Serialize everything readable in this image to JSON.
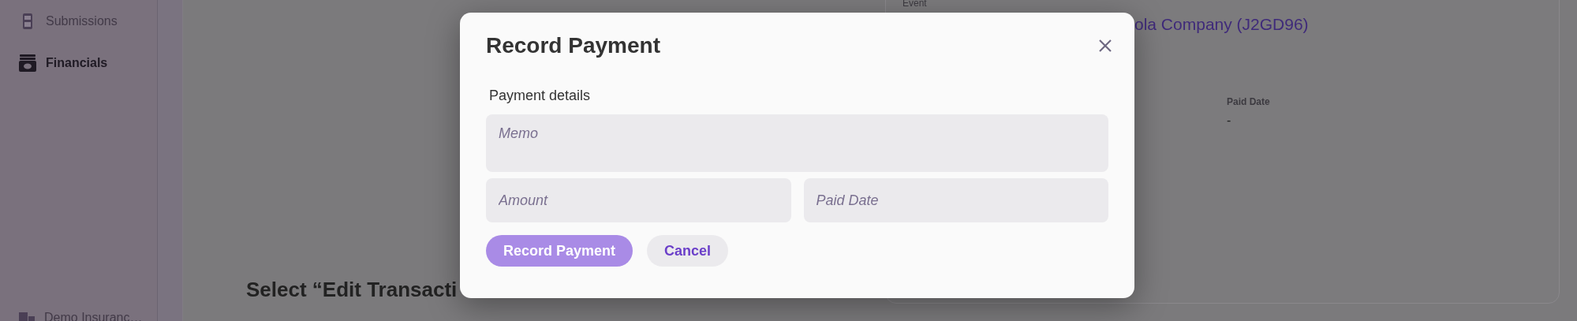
{
  "sidebar": {
    "items": [
      {
        "label": "Submissions",
        "selected": false,
        "kind": "device"
      },
      {
        "label": "Financials",
        "selected": true,
        "kind": "cash"
      }
    ],
    "footer": "Demo Insuranc…"
  },
  "main": {
    "heading": "Select “Edit Transacti"
  },
  "detail_card": {
    "event_label": "Event",
    "event_value": "ola Company (J2GD96)",
    "paid_date_label": "Paid Date",
    "paid_date_value": "-"
  },
  "modal": {
    "title": "Record Payment",
    "section_label": "Payment details",
    "fields": [
      {
        "placeholder": "Memo",
        "kind": "multiline"
      },
      {
        "placeholder": "Amount",
        "kind": "line"
      },
      {
        "placeholder": "Paid Date",
        "kind": "line"
      }
    ],
    "buttons": [
      {
        "label": "Record Payment",
        "kind": "primary",
        "disabled": true
      },
      {
        "label": "Cancel",
        "kind": "secondary",
        "disabled": false
      }
    ]
  }
}
